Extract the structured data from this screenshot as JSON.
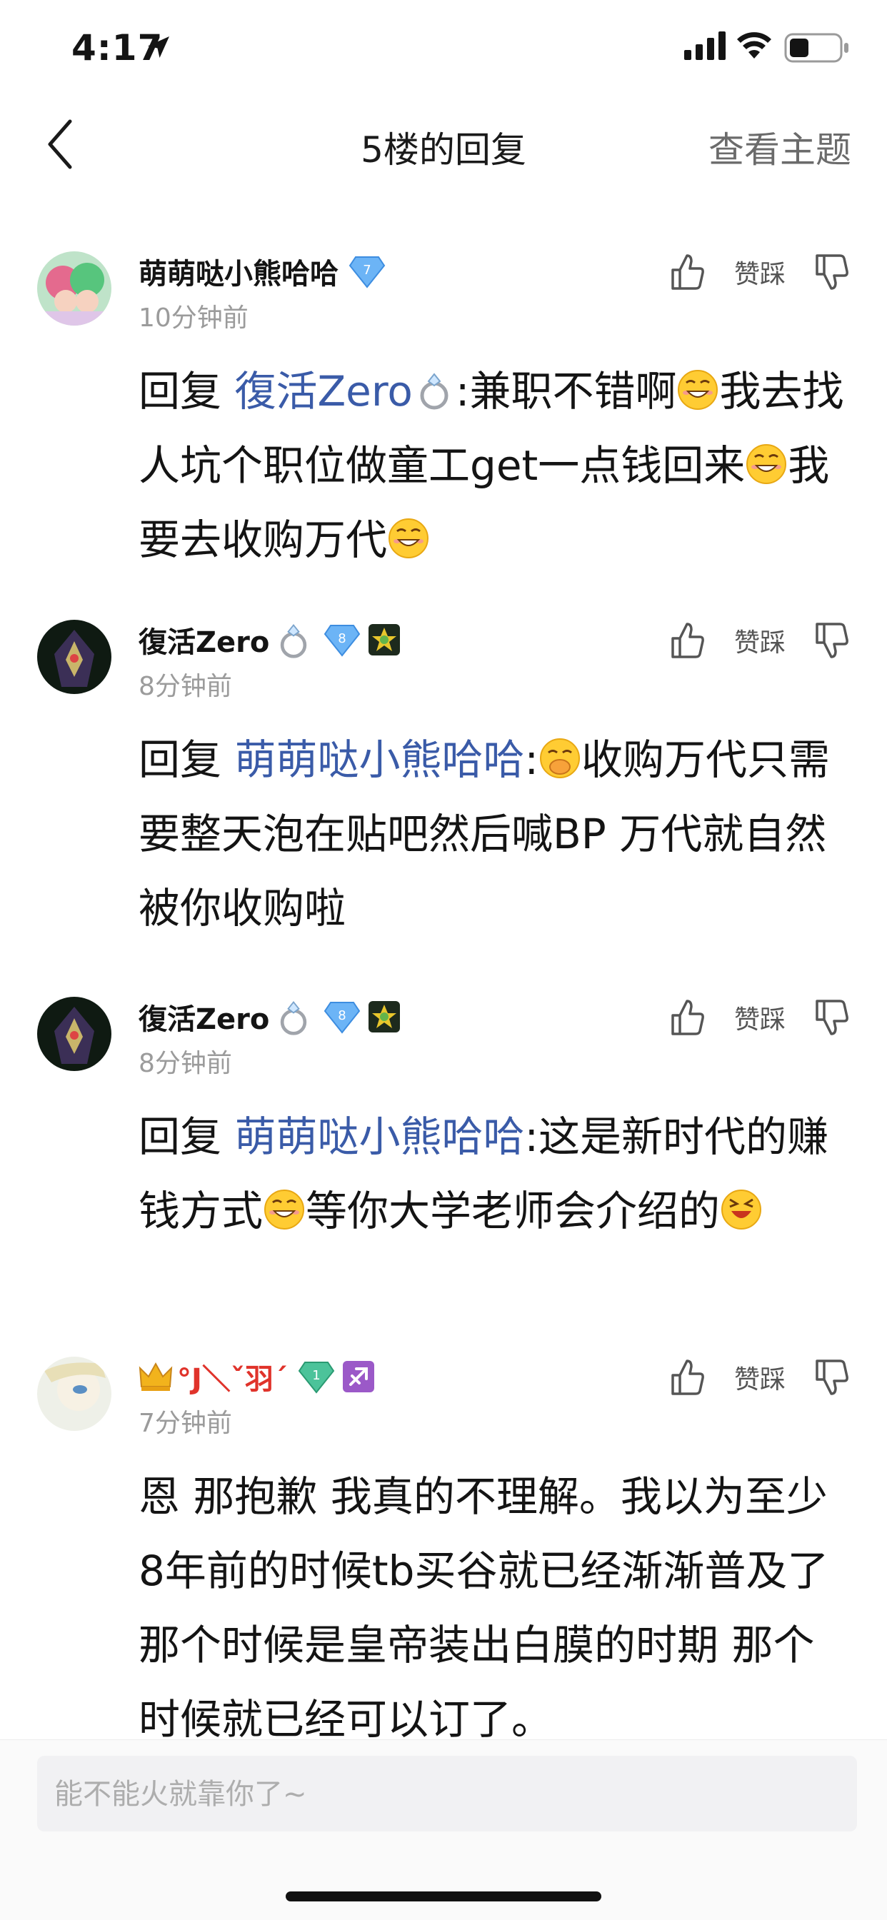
{
  "status_bar": {
    "time": "4:17"
  },
  "nav": {
    "title": "5楼的回复",
    "view_topic": "查看主题"
  },
  "actions": {
    "like_dislike_label": "赞踩"
  },
  "comments": [
    {
      "username": "萌萌哒小熊哈哈",
      "level": "7",
      "time": "10分钟前",
      "reply_prefix": "回复 ",
      "mention": "復活Zero",
      "body_parts": [
        ":兼职不错啊",
        "我去找人坑个职位做童工get一点钱回来",
        "我要去收购万代"
      ]
    },
    {
      "username": "復活Zero",
      "level": "8",
      "time": "8分钟前",
      "reply_prefix": "回复 ",
      "mention": "萌萌哒小熊哈哈",
      "body_parts": [
        ":",
        "收购万代只需要整天泡在贴吧然后喊BP 万代就自然被你收购啦"
      ]
    },
    {
      "username": "復活Zero",
      "level": "8",
      "time": "8分钟前",
      "reply_prefix": "回复 ",
      "mention": "萌萌哒小熊哈哈",
      "body_parts": [
        ":这是新时代的赚钱方式",
        "等你大学老师会介绍的"
      ]
    },
    {
      "username": "°J＼ˇ羽ˊ",
      "level": "1",
      "time": "7分钟前",
      "body": "恩 那抱歉 我真的不理解。我以为至少8年前的时候tb买谷就已经渐渐普及了 那个时候是皇帝装出白膜的时期 那个时候就已经可以订了。"
    }
  ],
  "input": {
    "placeholder": "能不能火就靠你了~"
  }
}
